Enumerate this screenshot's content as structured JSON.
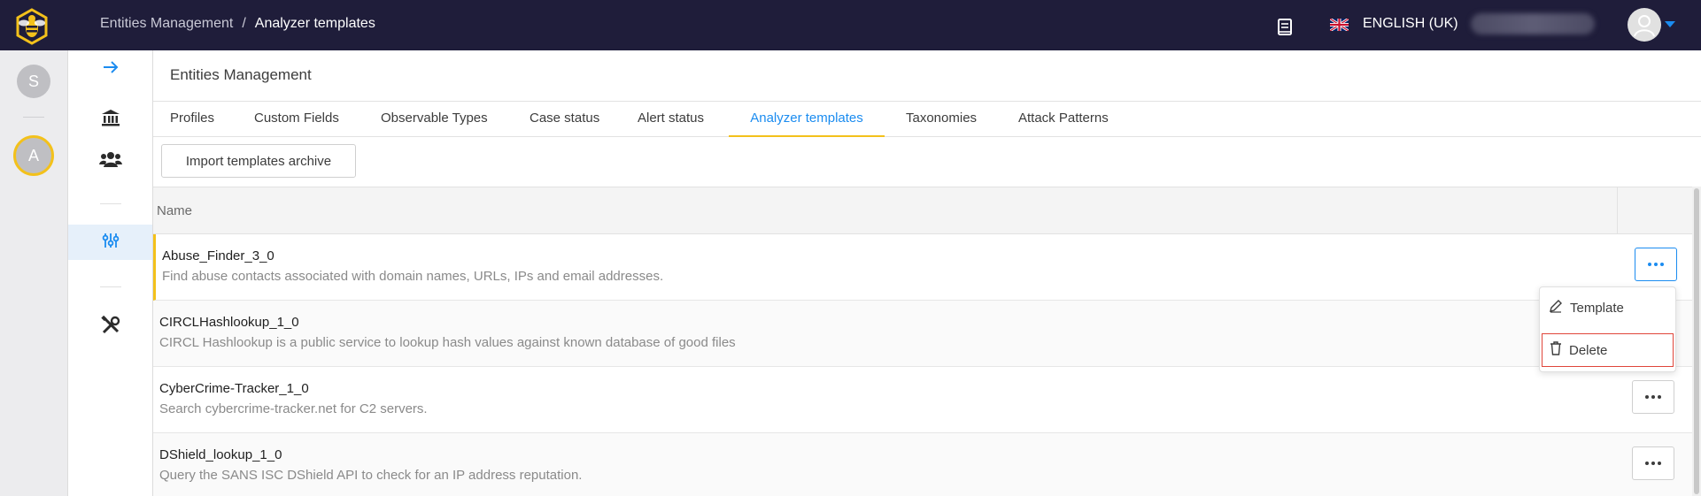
{
  "header": {
    "breadcrumb": [
      "Entities Management",
      "Analyzer templates"
    ],
    "breadcrumb_sep": "/",
    "language": "ENGLISH (UK)"
  },
  "org_rail": {
    "items": [
      {
        "initial": "S",
        "selected": false
      },
      {
        "initial": "A",
        "selected": true
      }
    ]
  },
  "nav_rail": {
    "icons": [
      "arrow-right-icon",
      "bank-icon",
      "users-icon",
      "sliders-icon",
      "tools-icon"
    ],
    "active": "sliders-icon"
  },
  "main": {
    "title": "Entities Management",
    "tabs": [
      {
        "label": "Profiles",
        "active": false
      },
      {
        "label": "Custom Fields",
        "active": false
      },
      {
        "label": "Observable Types",
        "active": false
      },
      {
        "label": "Case status",
        "active": false
      },
      {
        "label": "Alert status",
        "active": false
      },
      {
        "label": "Analyzer templates",
        "active": true
      },
      {
        "label": "Taxonomies",
        "active": false
      },
      {
        "label": "Attack Patterns",
        "active": false
      }
    ],
    "import_button": "Import templates archive",
    "table": {
      "header_name": "Name",
      "rows": [
        {
          "name": "Abuse_Finder_3_0",
          "description": "Find abuse contacts associated with domain names, URLs, IPs and email addresses."
        },
        {
          "name": "CIRCLHashlookup_1_0",
          "description": "CIRCL Hashlookup is a public service to lookup hash values against known database of good files"
        },
        {
          "name": "CyberCrime-Tracker_1_0",
          "description": "Search cybercrime-tracker.net for C2 servers."
        },
        {
          "name": "DShield_lookup_1_0",
          "description": "Query the SANS ISC DShield API to check for an IP address reputation."
        }
      ]
    },
    "row_menu": {
      "items": [
        {
          "label": "Template",
          "icon": "pencil-icon"
        },
        {
          "label": "Delete",
          "icon": "trash-icon"
        }
      ]
    }
  },
  "colors": {
    "topbar": "#1f1d3a",
    "accent": "#1b8cf0",
    "highlight": "#f3c11b",
    "delete_border": "#e0453a"
  }
}
